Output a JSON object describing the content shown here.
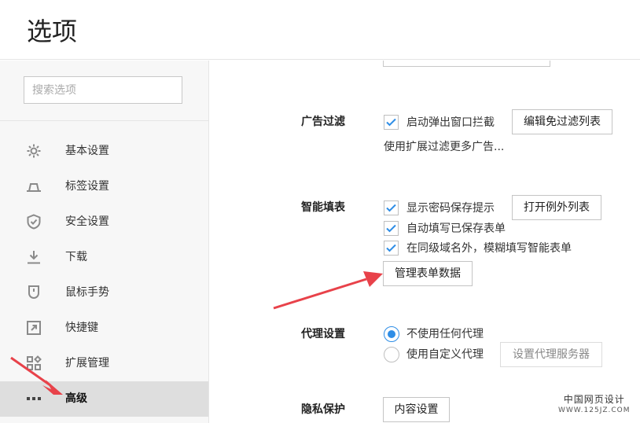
{
  "header": {
    "title": "选项"
  },
  "sidebar": {
    "search_placeholder": "搜索选项",
    "items": [
      {
        "label": "基本设置",
        "icon": "gear-icon"
      },
      {
        "label": "标签设置",
        "icon": "tab-icon"
      },
      {
        "label": "安全设置",
        "icon": "shield-check-icon"
      },
      {
        "label": "下载",
        "icon": "download-icon"
      },
      {
        "label": "鼠标手势",
        "icon": "mouse-icon"
      },
      {
        "label": "快捷键",
        "icon": "shortcut-icon"
      },
      {
        "label": "扩展管理",
        "icon": "extensions-icon"
      },
      {
        "label": "高级",
        "icon": "more-dots-icon",
        "active": true
      }
    ]
  },
  "sections": {
    "ad_filter": {
      "label": "广告过滤",
      "popup_block": {
        "label": "启动弹出窗口拦截",
        "checked": true
      },
      "edit_whitelist_button": "编辑免过滤列表",
      "hint": "使用扩展过滤更多广告..."
    },
    "autofill": {
      "label": "智能填表",
      "show_password_prompt": {
        "label": "显示密码保存提示",
        "checked": true
      },
      "open_exceptions_button": "打开例外列表",
      "auto_fill_saved": {
        "label": "自动填写已保存表单",
        "checked": true
      },
      "fuzzy_fill": {
        "label": "在同级域名外，模糊填写智能表单",
        "checked": true
      },
      "manage_form_data_button": "管理表单数据"
    },
    "proxy": {
      "label": "代理设置",
      "options": [
        {
          "label": "不使用任何代理",
          "selected": true
        },
        {
          "label": "使用自定义代理",
          "selected": false
        }
      ],
      "set_proxy_server_button": "设置代理服务器"
    },
    "privacy": {
      "label": "隐私保护",
      "content_settings_button": "内容设置"
    }
  },
  "watermark": {
    "name": "中国网页设计",
    "url": "WWW.125JZ.COM"
  },
  "colors": {
    "accent": "#2e8de6",
    "arrow": "#e8424a",
    "active_nav_bg": "#dedede"
  }
}
